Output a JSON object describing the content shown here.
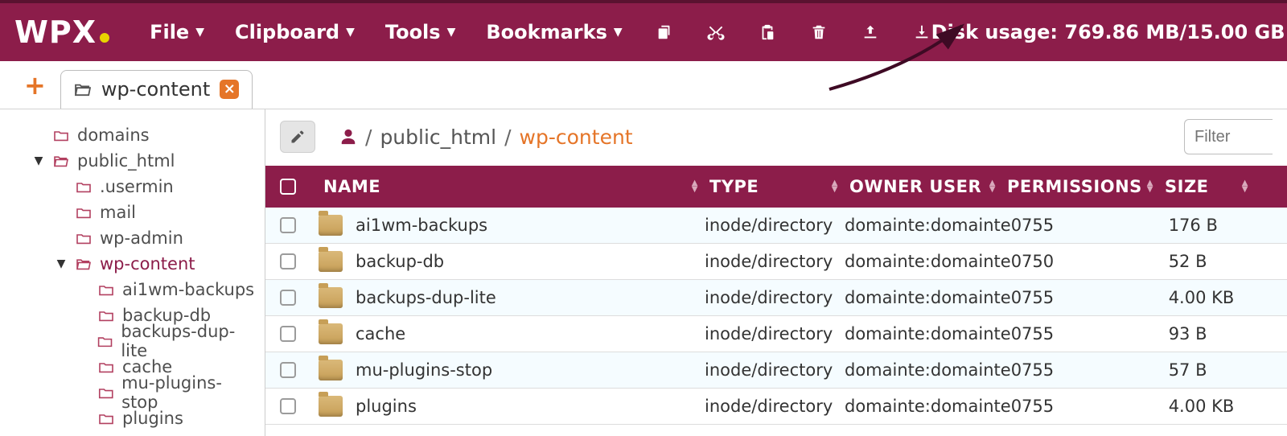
{
  "topbar": {
    "menus": [
      "File",
      "Clipboard",
      "Tools",
      "Bookmarks"
    ],
    "disk_usage": "Disk usage: 769.86 MB/15.00 GB"
  },
  "tab": {
    "label": "wp-content"
  },
  "sidebar": {
    "items": [
      {
        "label": "domains",
        "level": 0,
        "exp": false,
        "open": false,
        "active": false
      },
      {
        "label": "public_html",
        "level": 0,
        "exp": true,
        "open": true,
        "active": false
      },
      {
        "label": ".usermin",
        "level": 1,
        "exp": false,
        "open": false,
        "active": false
      },
      {
        "label": "mail",
        "level": 1,
        "exp": false,
        "open": false,
        "active": false
      },
      {
        "label": "wp-admin",
        "level": 1,
        "exp": false,
        "open": false,
        "active": false
      },
      {
        "label": "wp-content",
        "level": 1,
        "exp": true,
        "open": true,
        "active": true
      },
      {
        "label": "ai1wm-backups",
        "level": 2,
        "exp": false,
        "open": false,
        "active": false
      },
      {
        "label": "backup-db",
        "level": 2,
        "exp": false,
        "open": false,
        "active": false
      },
      {
        "label": "backups-dup-lite",
        "level": 2,
        "exp": false,
        "open": false,
        "active": false
      },
      {
        "label": "cache",
        "level": 2,
        "exp": false,
        "open": false,
        "active": false
      },
      {
        "label": "mu-plugins-stop",
        "level": 2,
        "exp": false,
        "open": false,
        "active": false
      },
      {
        "label": "plugins",
        "level": 2,
        "exp": false,
        "open": false,
        "active": false
      }
    ]
  },
  "breadcrumb": {
    "seg1": "public_html",
    "seg2": "wp-content"
  },
  "filter_placeholder": "Filter",
  "columns": {
    "name": "NAME",
    "type": "TYPE",
    "owner": "OWNER USER",
    "perm": "PERMISSIONS",
    "size": "SIZE"
  },
  "rows": [
    {
      "name": "ai1wm-backups",
      "type": "inode/directory",
      "owner": "domainte:domainte",
      "perm": "0755",
      "size": "176 B"
    },
    {
      "name": "backup-db",
      "type": "inode/directory",
      "owner": "domainte:domainte",
      "perm": "0750",
      "size": "52 B"
    },
    {
      "name": "backups-dup-lite",
      "type": "inode/directory",
      "owner": "domainte:domainte",
      "perm": "0755",
      "size": "4.00 KB"
    },
    {
      "name": "cache",
      "type": "inode/directory",
      "owner": "domainte:domainte",
      "perm": "0755",
      "size": "93 B"
    },
    {
      "name": "mu-plugins-stop",
      "type": "inode/directory",
      "owner": "domainte:domainte",
      "perm": "0755",
      "size": "57 B"
    },
    {
      "name": "plugins",
      "type": "inode/directory",
      "owner": "domainte:domainte",
      "perm": "0755",
      "size": "4.00 KB"
    }
  ]
}
